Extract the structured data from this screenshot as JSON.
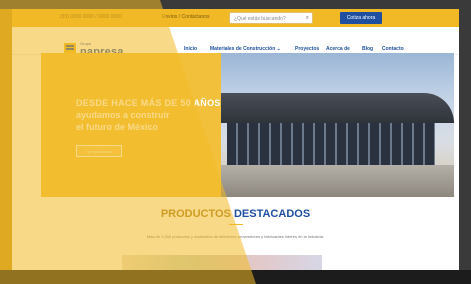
{
  "topbar": {
    "phone": "(55) 0000 0000 / 0000 0000",
    "contact": "Envíos / Contáctanos",
    "search_placeholder": "¿Qué estás buscando?",
    "search_icon": "search-icon",
    "cta_label": "Cotiza ahora"
  },
  "brand": {
    "small": "Grupo",
    "name": "napresa."
  },
  "nav": {
    "items": [
      "Inicio",
      "Materiales de Construcción ⌄",
      "Proyectos",
      "Acerca de",
      "Blog",
      "Contacto"
    ],
    "active_index": 0
  },
  "hero": {
    "line1": "DESDE HACE MÁS DE 50 AÑOS",
    "line2": "ayudamos a construir",
    "line3": "el futuro de México",
    "button": "Ver productos"
  },
  "section": {
    "title_part1": "PRODUCTOS",
    "title_part2": "DESTACADOS",
    "subtitle": "Más de 1,000 productos y materiales de diferentes proveedores y fabricantes líderes en la industria."
  },
  "colors": {
    "accent": "#f2b927",
    "brand_blue": "#1f4fa0",
    "white": "#ffffff"
  }
}
